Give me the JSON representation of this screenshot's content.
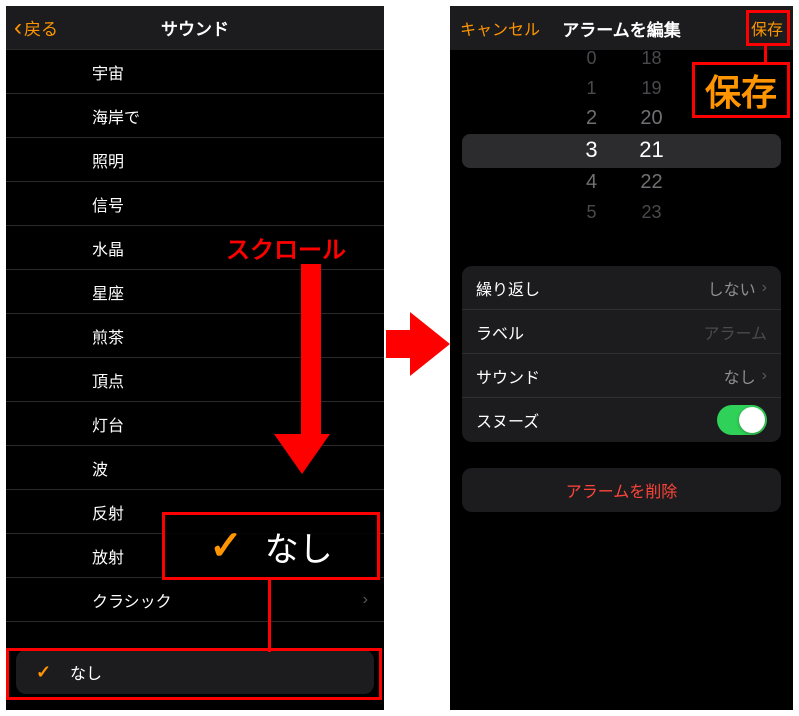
{
  "left": {
    "back_label": "戻る",
    "title": "サウンド",
    "sounds": [
      "宇宙",
      "海岸で",
      "照明",
      "信号",
      "水晶",
      "星座",
      "煎茶",
      "頂点",
      "灯台",
      "波",
      "反射",
      "放射",
      "クラシック"
    ],
    "none_label": "なし",
    "selected_index": -1,
    "none_selected": true,
    "scroll_annotation": "スクロール",
    "callout_check": "✓",
    "callout_text": "なし"
  },
  "right": {
    "cancel_label": "キャンセル",
    "title": "アラームを編集",
    "save_label": "保存",
    "save_big": "保存",
    "picker": {
      "hours": [
        "0",
        "1",
        "2",
        "3",
        "4",
        "5",
        ""
      ],
      "minutes": [
        "18",
        "19",
        "20",
        "21",
        "22",
        "23",
        ""
      ],
      "sel_hour_idx": 3,
      "sel_min_idx": 3
    },
    "settings": {
      "repeat_label": "繰り返し",
      "repeat_value": "しない",
      "label_label": "ラベル",
      "label_value": "アラーム",
      "sound_label": "サウンド",
      "sound_value": "なし",
      "snooze_label": "スヌーズ",
      "snooze_on": true
    },
    "delete_label": "アラームを削除"
  }
}
